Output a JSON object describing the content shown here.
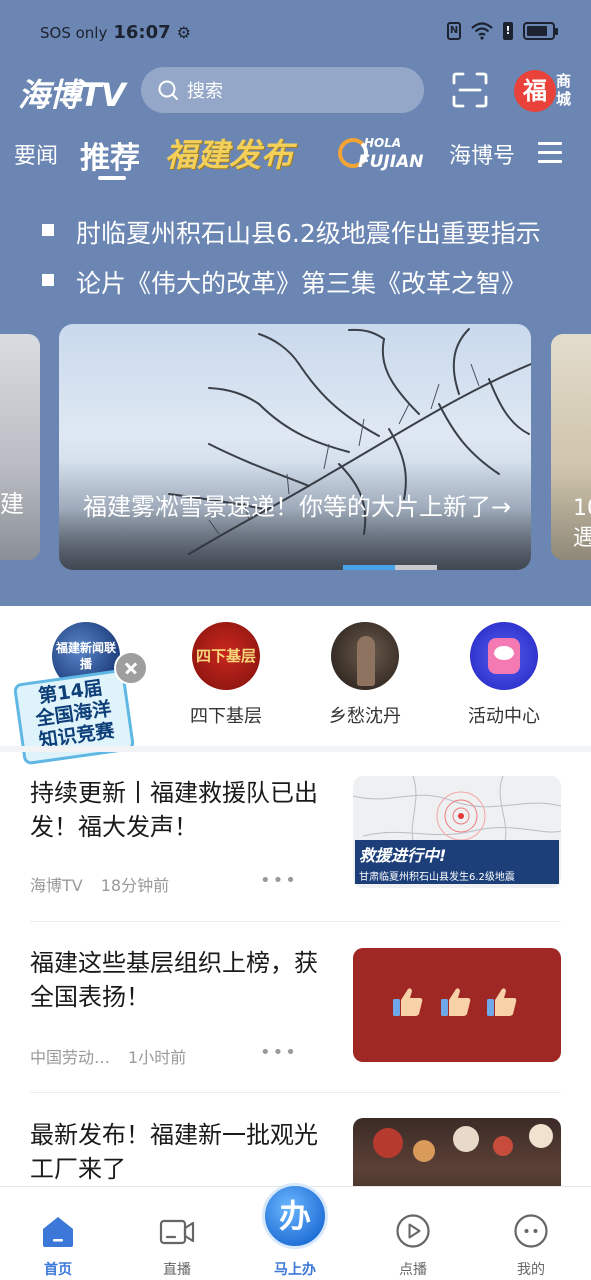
{
  "status_bar": {
    "carrier": "SOS only",
    "time": "16:07",
    "battery_level": 0.85
  },
  "header": {
    "logo": "海博TV",
    "search_placeholder": "搜索",
    "mall_label": "商城",
    "mall_logo_char": "福"
  },
  "tabs": [
    {
      "label": "要闻"
    },
    {
      "label": "推荐",
      "active": true
    },
    {
      "label": "福建发布"
    },
    {
      "label": "HOLA"
    },
    {
      "label": "FUJIAN"
    },
    {
      "label": "海博号"
    }
  ],
  "ticker": [
    "肘临夏州积石山县6.2级地震作出重要指示",
    "论片《伟大的改革》第三集《改革之智》"
  ],
  "carousel": {
    "main_caption": "福建雾凇雪景速递！你等的大片上新了→",
    "left_peek_text": "建",
    "right_peek_text": "10\n遇",
    "active_index": 1
  },
  "shortcuts": [
    {
      "label": "播",
      "icon_text": "福建新闻联播"
    },
    {
      "label": "四下基层",
      "icon_text": "四下基层"
    },
    {
      "label": "乡愁沈丹"
    },
    {
      "label": "活动中心"
    }
  ],
  "promo": {
    "line1": "第14届",
    "line2": "全国海洋",
    "line3": "知识竞赛"
  },
  "news": [
    {
      "title": "持续更新丨福建救援队已出发！福大发声！",
      "source": "海博TV",
      "time": "18分钟前",
      "thumb_banner": "救援进行中!",
      "thumb_sub": "甘肃临夏州积石山县发生6.2级地震"
    },
    {
      "title": "福建这些基层组织上榜，获全国表扬！",
      "source": "中国劳动…",
      "time": "1小时前"
    },
    {
      "title": "最新发布！福建新一批观光工厂来了",
      "source": "",
      "time": ""
    }
  ],
  "more_glyph": "•••",
  "bottom_nav": [
    {
      "label": "首页",
      "active": true,
      "icon": "home-icon"
    },
    {
      "label": "直播",
      "icon": "live-camera-icon"
    },
    {
      "label": "马上办",
      "icon": "ban-badge",
      "badge_char": "办"
    },
    {
      "label": "点播",
      "icon": "play-circle-icon"
    },
    {
      "label": "我的",
      "icon": "face-icon"
    }
  ],
  "colors": {
    "header_bg": "#6b86b3",
    "accent_blue": "#3c78d8",
    "brand_red": "#e8423a"
  }
}
